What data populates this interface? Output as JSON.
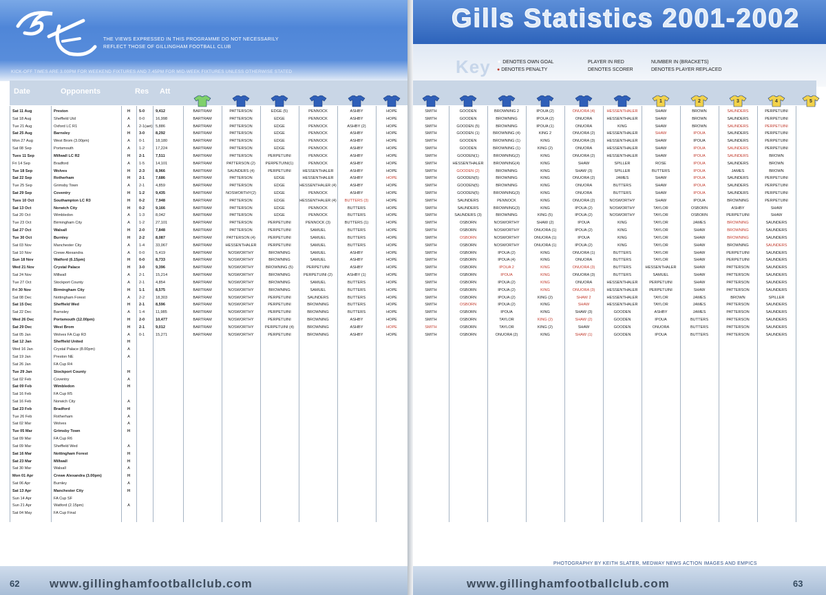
{
  "left": {
    "disclaimer_1": "THE VIEWS EXPRESSED IN THIS PROGRAMME DO NOT NECESSARILY",
    "disclaimer_2": "REFLECT THOSE OF GILLINGHAM FOOTBALL CLUB",
    "kickoff": "KICK-OFF TIMES ARE 3.00PM FOR WEEKEND FIXTURES AND 7.45PM FOR MID-WEEK FIXTURES UNLESS OTHERWISE STATED",
    "headers": [
      "Date",
      "Opponents",
      "Res",
      "Att"
    ],
    "page_number": "62",
    "url": "www.gillinghamfootballclub.com"
  },
  "right": {
    "title": "Gills Statistics 2001-2002",
    "key_title": "Key",
    "key": [
      "DENOTES OWN GOAL",
      "DENOTES PENALTY",
      "PLAYER IN RED",
      "DENOTES SCORER",
      "NUMBER IN (BRACKETS)",
      "DENOTES PLAYER REPLACED"
    ],
    "sub_numbers": [
      "1",
      "2",
      "3",
      "4",
      "5"
    ],
    "credit": "PHOTOGRAPHY BY KEITH SLATER, MEDWAY NEWS ACTION IMAGES AND EMPICS",
    "page_number": "63",
    "url": "www.gillinghamfootballclub.com"
  },
  "fixtures": [
    {
      "date": "Sat 11 Aug",
      "opp": "Preston",
      "ha": "H",
      "res": "5-0",
      "att": "9,412",
      "p": [
        "BARTRAM",
        "PATTERSON",
        "EDGE (5)",
        "PENNOCK",
        "ASHBY",
        "HOPE",
        "SMITH",
        "GOODEN",
        "BROWNING 2",
        "IPOUA (2)",
        "ONUORA (4)",
        "HESSENTHALER",
        "SHAW",
        "BROWN",
        "SAUNDERS",
        "PERPETUINI"
      ],
      "bold": true
    },
    {
      "date": "Sat 18 Aug",
      "opp": "Sheffield Utd",
      "ha": "A",
      "res": "0-0",
      "att": "16,998",
      "p": [
        "BARTRAM",
        "PATTERSON",
        "EDGE",
        "PENNOCK",
        "ASHBY",
        "HOPE",
        "SMITH",
        "GOODEN",
        "BROWNING",
        "IPOUA (2)",
        "ONUORA",
        "HESSENTHALER",
        "SHAW",
        "BROWN",
        "SAUNDERS",
        "PERPETUINI"
      ]
    },
    {
      "date": "Tue 21 Aug",
      "opp": "Oxford LC R1",
      "ha": "A",
      "res": "2-1(aet)",
      "att": "5,886",
      "p": [
        "BARTRAM",
        "PATTERSON",
        "EDGE",
        "PENNOCK",
        "ASHBY (2)",
        "HOPE",
        "SMITH",
        "GOODEN (5)",
        "BROWNING",
        "IPOUA (1)",
        "ONUORA",
        "KING",
        "SHAW",
        "BROWN",
        "SAUNDERS",
        "PERPETUINI"
      ]
    },
    {
      "date": "Sat 25 Aug",
      "opp": "Barnsley",
      "ha": "H",
      "res": "3-0",
      "att": "8,292",
      "p": [
        "BARTRAM",
        "PATTERSON",
        "EDGE",
        "PENNOCK",
        "ASHBY",
        "HOPE",
        "SMITH",
        "GOODEN (1)",
        "BROWNING (4)",
        "KING 2",
        "ONUORA (2)",
        "HESSENTHALER",
        "SHAW",
        "IPOUA",
        "SAUNDERS",
        "PERPETUINI"
      ],
      "bold": true
    },
    {
      "date": "Mon 27 Aug",
      "opp": "West Brom (3.00pm)",
      "ha": "A",
      "res": "0-1",
      "att": "18,180",
      "p": [
        "BARTRAM",
        "PATTERSON",
        "EDGE",
        "PENNOCK",
        "ASHBY",
        "HOPE",
        "SMITH",
        "GOODEN",
        "BROWNING (1)",
        "KING",
        "ONUORA (3)",
        "HESSENTHALER",
        "SHAW",
        "IPOUA",
        "SAUNDERS",
        "PERPETUINI"
      ]
    },
    {
      "date": "Sat 08 Sep",
      "opp": "Portsmouth",
      "ha": "A",
      "res": "1-2",
      "att": "17,224",
      "p": [
        "BARTRAM",
        "PATTERSON",
        "EDGE",
        "PENNOCK",
        "ASHBY",
        "HOPE",
        "SMITH",
        "GOODEN",
        "BROWNING (1)",
        "KING (2)",
        "ONUORA",
        "HESSENTHALER",
        "SHAW",
        "IPOUA",
        "SAUNDERS",
        "PERPETUINI"
      ]
    },
    {
      "date": "Tues 11 Sep",
      "opp": "Millwall LC R2",
      "ha": "H",
      "res": "2-1",
      "att": "7,511",
      "p": [
        "BARTRAM",
        "PATTERSON",
        "PERPETUINI",
        "PENNOCK",
        "ASHBY",
        "HOPE",
        "SMITH",
        "GOODEN(1)",
        "BROWNING(2)",
        "KING",
        "ONUORA (2)",
        "HESSENTHALER",
        "SHAW",
        "IPOUA",
        "SAUNDERS",
        "BROWN"
      ],
      "bold": true
    },
    {
      "date": "Fri 14 Sep",
      "opp": "Bradford",
      "ha": "A",
      "res": "1-5",
      "att": "14,101",
      "p": [
        "BARTRAM",
        "PATTERSON (2)",
        "PERPETUINI(1)",
        "PENNOCK",
        "ASHBY",
        "HOPE",
        "SMITH",
        "HESSENTHALER",
        "BROWNING(4)",
        "KING",
        "SHAW",
        "SPILLER",
        "ROSE",
        "IPOUA",
        "SAUNDERS",
        "BROWN"
      ]
    },
    {
      "date": "Tue 18 Sep",
      "opp": "Wolves",
      "ha": "H",
      "res": "2-3",
      "att": "8,966",
      "p": [
        "BARTRAM",
        "SAUNDERS (4)",
        "PERPETUINI",
        "HESSENTHALER",
        "ASHBY",
        "HOPE",
        "SMITH",
        "GOODEN (2)",
        "BROWNING",
        "KING",
        "SHAW (3)",
        "SPILLER",
        "BUTTERS",
        "IPOUA",
        "JAMES",
        "BROWN"
      ],
      "bold": true
    },
    {
      "date": "Sat 22 Sep",
      "opp": "Rotherham",
      "ha": "H",
      "res": "2-1",
      "att": "7,686",
      "p": [
        "BARTRAM",
        "PATTERSON",
        "EDGE",
        "HESSENTHALER",
        "ASHBY",
        "HOPE",
        "SMITH",
        "GOODEN(5)",
        "BROWNING",
        "KING",
        "ONUORA (2)",
        "JAMES",
        "SHAW",
        "IPOUA",
        "SAUNDERS",
        "PERPETUINI"
      ],
      "bold": true
    },
    {
      "date": "Tue 25 Sep",
      "opp": "Grimsby Town",
      "ha": "A",
      "res": "2-1",
      "att": "4,859",
      "p": [
        "BARTRAM",
        "PATTERSON",
        "EDGE",
        "HESSENTHALER (4)",
        "ASHBY",
        "HOPE",
        "SMITH",
        "GOODEN(5)",
        "BROWNING",
        "KING",
        "ONUORA",
        "BUTTERS",
        "SHAW",
        "IPOUA",
        "SAUNDERS",
        "PERPETUINI"
      ]
    },
    {
      "date": "Sat 29 Sep",
      "opp": "Coventry",
      "ha": "H",
      "res": "1-2",
      "att": "9,435",
      "p": [
        "BARTRAM",
        "NOSWORTHY(2)",
        "EDGE",
        "PENNOCK",
        "ASHBY",
        "HOPE",
        "SMITH",
        "GOODEN(5)",
        "BROWNING(3)",
        "KING",
        "ONUORA",
        "BUTTERS",
        "SHAW",
        "IPOUA",
        "SAUNDERS",
        "PERPETUINI"
      ],
      "bold": true
    },
    {
      "date": "Tues 10 Oct",
      "opp": "Southampton LC R3",
      "ha": "H",
      "res": "0-2",
      "att": "7,948",
      "p": [
        "BARTRAM",
        "PATTERSON",
        "EDGE",
        "HESSENTHALER (4)",
        "BUTTERS (3)",
        "HOPE",
        "SMITH",
        "SAUNDERS",
        "PENNOCK",
        "KING",
        "ONUORA (2)",
        "NOSWORTHY",
        "SHAW",
        "IPOUA",
        "BROWNING",
        "PERPETUINI"
      ],
      "bold": true
    },
    {
      "date": "Sat 13 Oct",
      "opp": "Norwich City",
      "ha": "H",
      "res": "0-2",
      "att": "9,166",
      "p": [
        "BARTRAM",
        "PATTERSON",
        "EDGE",
        "PENNOCK",
        "BUTTERS",
        "HOPE",
        "SMITH",
        "SAUNDERS",
        "BROWNING(3)",
        "KING",
        "IPOUA (2)",
        "NOSWORTHY",
        "TAYLOR",
        "OSBORN",
        "ASHBY",
        "SHAW"
      ],
      "bold": true
    },
    {
      "date": "Sat 20 Oct",
      "opp": "Wimbledon",
      "ha": "A",
      "res": "1-3",
      "att": "8,042",
      "p": [
        "BARTRAM",
        "PATTERSON",
        "EDGE",
        "PENNOCK",
        "BUTTERS",
        "HOPE",
        "SMITH",
        "SAUNDERS (3)",
        "BROWNING",
        "KING (5)",
        "IPOUA (2)",
        "NOSWORTHY",
        "TAYLOR",
        "OSBORN",
        "PERPETUINI",
        "SHAW"
      ]
    },
    {
      "date": "Tue 23 Oct",
      "opp": "Birmingham City",
      "ha": "A",
      "res": "1-2",
      "att": "27,101",
      "p": [
        "BARTRAM",
        "PATTERSON",
        "PERPETUINI",
        "PENNOCK (3)",
        "BUTTERS (1)",
        "HOPE",
        "SMITH",
        "OSBORN",
        "NOSWORTHY",
        "SHAW (2)",
        "IPOUA",
        "KING",
        "TAYLOR",
        "JAMES",
        "BROWNING",
        "SAUNDERS"
      ]
    },
    {
      "date": "Sat 27 Oct",
      "opp": "Walsall",
      "ha": "H",
      "res": "2-0",
      "att": "7,848",
      "p": [
        "BARTRAM",
        "PATTERSON",
        "PERPETUINI",
        "SAMUEL",
        "BUTTERS",
        "HOPE",
        "SMITH",
        "OSBORN",
        "NOSWORTHY",
        "ONUORA (1)",
        "IPOUA (2)",
        "KING",
        "TAYLOR",
        "SHAW",
        "BROWNING",
        "SAUNDERS"
      ],
      "bold": true
    },
    {
      "date": "Tue 30 Oct",
      "opp": "Burnley",
      "ha": "H",
      "res": "2-2",
      "att": "8,087",
      "p": [
        "BARTRAM",
        "PATTERSON (4)",
        "PERPETUINI",
        "SAMUEL",
        "BUTTERS",
        "HOPE",
        "SMITH",
        "OSBORN",
        "NOSWORTHY",
        "ONUORA (1)",
        "IPOUA",
        "KING",
        "TAYLOR",
        "SHAW",
        "BROWNING",
        "SAUNDERS"
      ],
      "bold": true
    },
    {
      "date": "Sat 03 Nov",
      "opp": "Manchester City",
      "ha": "A",
      "res": "1-4",
      "att": "33,067",
      "p": [
        "BARTRAM",
        "HESSENTHALER",
        "PERPETUINI",
        "SAMUEL",
        "BUTTERS",
        "HOPE",
        "SMITH",
        "OSBORN",
        "NOSWORTHY",
        "ONUORA (1)",
        "IPOUA (2)",
        "KING",
        "TAYLOR",
        "SHAW",
        "BROWNING",
        "SAUNDERS"
      ]
    },
    {
      "date": "Sat 10 Nov",
      "opp": "Crewe Alexandra",
      "ha": "A",
      "res": "0-0",
      "att": "5,419",
      "p": [
        "BARTRAM",
        "NOSWORTHY",
        "BROWNING",
        "SAMUEL",
        "ASHBY",
        "HOPE",
        "SMITH",
        "OSBORN",
        "IPOUA (2)",
        "KING",
        "ONUORA (1)",
        "BUTTERS",
        "TAYLOR",
        "SHAW",
        "PERPETUINI",
        "SAUNDERS"
      ]
    },
    {
      "date": "Sun 18 Nov",
      "opp": "Watford (6.15pm)",
      "ha": "H",
      "res": "0-0",
      "att": "8,733",
      "p": [
        "BARTRAM",
        "NOSWORTHY",
        "BROWNING",
        "SAMUEL",
        "ASHBY",
        "HOPE",
        "SMITH",
        "OSBORN",
        "IPOUA (4)",
        "KING",
        "ONUORA",
        "BUTTERS",
        "TAYLOR",
        "SHAW",
        "PERPETUINI",
        "SAUNDERS"
      ],
      "bold": true
    },
    {
      "date": "Wed 21 Nov",
      "opp": "Crystal Palace",
      "ha": "H",
      "res": "3-0",
      "att": "9,396",
      "p": [
        "BARTRAM",
        "NOSWORTHY",
        "BROWNING (5)",
        "PERPETUINI",
        "ASHBY",
        "HOPE",
        "SMITH",
        "OSBORN",
        "IPOUA 2",
        "KING",
        "ONUORA (3)",
        "BUTTERS",
        "HESSENTHALER",
        "SHAW",
        "PATTERSON",
        "SAUNDERS"
      ],
      "bold": true
    },
    {
      "date": "Sat 24 Nov",
      "opp": "Millwall",
      "ha": "A",
      "res": "2-1",
      "att": "15,214",
      "p": [
        "BARTRAM",
        "NOSWORTHY",
        "BROWNING",
        "PERPETUINI (2)",
        "ASHBY (1)",
        "HOPE",
        "SMITH",
        "OSBORN",
        "IPOUA",
        "KING",
        "ONUORA (3)",
        "BUTTERS",
        "SAMUEL",
        "SHAW",
        "PATTERSON",
        "SAUNDERS"
      ]
    },
    {
      "date": "Tue 27 Oct",
      "opp": "Stockport County",
      "ha": "A",
      "res": "2-1",
      "att": "4,854",
      "p": [
        "BARTRAM",
        "NOSWORTHY",
        "BROWNING",
        "SAMUEL",
        "BUTTERS",
        "HOPE",
        "SMITH",
        "OSBORN",
        "IPOUA (2)",
        "KING",
        "ONUORA",
        "HESSENTHALER",
        "PERPETUINI",
        "SHAW",
        "PATTERSON",
        "SAUNDERS"
      ]
    },
    {
      "date": "Fri 30 Nov",
      "opp": "Birmingham City",
      "ha": "H",
      "res": "1-1",
      "att": "8,575",
      "p": [
        "BARTRAM",
        "NOSWORTHY",
        "BROWNING",
        "SAMUEL",
        "BUTTERS",
        "HOPE",
        "SMITH",
        "OSBORN",
        "IPOUA (2)",
        "KING",
        "ONUORA (3)",
        "HESSENTHALER",
        "PERPETUINI",
        "SHAW",
        "PATTERSON",
        "SAUNDERS"
      ],
      "bold": true
    },
    {
      "date": "Sat 08 Dec",
      "opp": "Nottingham Forest",
      "ha": "A",
      "res": "2-2",
      "att": "18,303",
      "p": [
        "BARTRAM",
        "NOSWORTHY",
        "PERPETUINI",
        "SAUNDERS",
        "BUTTERS",
        "HOPE",
        "SMITH",
        "OSBORN",
        "IPOUA (2)",
        "KING (2)",
        "SHAW 2",
        "HESSENTHALER",
        "TAYLOR",
        "JAMES",
        "BROWN",
        "SPILLER"
      ]
    },
    {
      "date": "Sat 15 Dec",
      "opp": "Sheffield Wed",
      "ha": "H",
      "res": "2-1",
      "att": "8,596",
      "p": [
        "BARTRAM",
        "NOSWORTHY",
        "PERPETUINI",
        "BROWNING",
        "BUTTERS",
        "HOPE",
        "SMITH",
        "OSBORN",
        "IPOUA (2)",
        "KING",
        "SHAW",
        "HESSENTHALER",
        "TAYLOR",
        "JAMES",
        "PATTERSON",
        "SAUNDERS"
      ],
      "bold": true
    },
    {
      "date": "Sat 22 Dec",
      "opp": "Barnsley",
      "ha": "A",
      "res": "1-4",
      "att": "11,985",
      "p": [
        "BARTRAM",
        "NOSWORTHY",
        "PERPETUINI",
        "BROWNING",
        "BUTTERS",
        "HOPE",
        "SMITH",
        "OSBORN",
        "IPOUA",
        "KING",
        "SHAW (3)",
        "GOODEN",
        "ASHBY",
        "JAMES",
        "PATTERSON",
        "SAUNDERS"
      ]
    },
    {
      "date": "Wed 26 Dec",
      "opp": "Portsmouth (12.00pm)",
      "ha": "H",
      "res": "2-0",
      "att": "10,477",
      "p": [
        "BARTRAM",
        "NOSWORTHY",
        "PERPETUINI",
        "BROWNING",
        "ASHBY",
        "HOPE",
        "SMITH",
        "OSBORN",
        "TAYLOR",
        "KING (2)",
        "SHAW (2)",
        "GOODEN",
        "IPOUA",
        "BUTTERS",
        "PATTERSON",
        "SAUNDERS"
      ],
      "bold": true
    },
    {
      "date": "Sat 29 Dec",
      "opp": "West Brom",
      "ha": "H",
      "res": "2-1",
      "att": "9,012",
      "p": [
        "BARTRAM",
        "NOSWORTHY",
        "PERPETUINI (4)",
        "BROWNING",
        "ASHBY",
        "HOPE",
        "SMITH",
        "OSBORN",
        "TAYLOR",
        "KING (2)",
        "SHAW",
        "GOODEN",
        "ONUORA",
        "BUTTERS",
        "PATTERSON",
        "SAUNDERS"
      ],
      "bold": true
    },
    {
      "date": "Sat 05 Jan",
      "opp": "Wolves FA Cup R3",
      "ha": "A",
      "res": "0-1",
      "att": "15,271",
      "p": [
        "BARTRAM",
        "NOSWORTHY",
        "PERPETUINI",
        "BROWNING",
        "ASHBY",
        "HOPE",
        "SMITH",
        "OSBORN",
        "ONUORA (2)",
        "KING",
        "SHAW (1)",
        "GOODEN",
        "IPOUA",
        "BUTTERS",
        "PATTERSON",
        "SAUNDERS"
      ]
    },
    {
      "date": "Sat 12 Jan",
      "opp": "Sheffield United",
      "ha": "H",
      "bold": true
    },
    {
      "date": "Wed 16 Jan",
      "opp": "Crystal Palace (8.00pm)",
      "ha": "A"
    },
    {
      "date": "Sat 19 Jan",
      "opp": "Preston NE",
      "ha": "A"
    },
    {
      "date": "Sat 26 Jan",
      "opp": "FA Cup R4",
      "ha": ""
    },
    {
      "date": "Tue 29 Jan",
      "opp": "Stockport County",
      "ha": "H",
      "bold": true
    },
    {
      "date": "Sat 02 Feb",
      "opp": "Coventry",
      "ha": "A"
    },
    {
      "date": "Sat 09 Feb",
      "opp": "Wimbledon",
      "ha": "H",
      "bold": true
    },
    {
      "date": "Sat 16 Feb",
      "opp": "FA Cup R5",
      "ha": ""
    },
    {
      "date": "Sat 16 Feb",
      "opp": "Norwich City",
      "ha": "A"
    },
    {
      "date": "Sat 23 Feb",
      "opp": "Bradford",
      "ha": "H",
      "bold": true
    },
    {
      "date": "Tue 26 Feb",
      "opp": "Rotherham",
      "ha": "A"
    },
    {
      "date": "Sat 02 Mar",
      "opp": "Wolves",
      "ha": "A"
    },
    {
      "date": "Tue 05 Mar",
      "opp": "Grimsby Town",
      "ha": "H",
      "bold": true
    },
    {
      "date": "Sat 09 Mar",
      "opp": "FA Cup R6",
      "ha": ""
    },
    {
      "date": "Sat 09 Mar",
      "opp": "Sheffield Wed",
      "ha": "A"
    },
    {
      "date": "Sat 16 Mar",
      "opp": "Nottingham Forest",
      "ha": "H",
      "bold": true
    },
    {
      "date": "Sat 23 Mar",
      "opp": "Millwall",
      "ha": "H",
      "bold": true
    },
    {
      "date": "Sat 30 Mar",
      "opp": "Walsall",
      "ha": "A"
    },
    {
      "date": "Mon 01 Apr",
      "opp": "Crewe Alexandra (3.00pm)",
      "ha": "H",
      "bold": true
    },
    {
      "date": "Sat 06 Apr",
      "opp": "Burnley",
      "ha": "A"
    },
    {
      "date": "Sat 13 Apr",
      "opp": "Manchester City",
      "ha": "H",
      "bold": true
    },
    {
      "date": "Sun 14 Apr",
      "opp": "FA Cup SF",
      "ha": ""
    },
    {
      "date": "Sun 21 Apr",
      "opp": "Watford (2.15pm)",
      "ha": "A"
    },
    {
      "date": "Sat 04 May",
      "opp": "FA Cup Final",
      "ha": ""
    }
  ],
  "colors": {
    "blue_band": "#4f86d8",
    "shirt_blue": "#2f5fb8",
    "shirt_green": "#7fd06b",
    "shirt_yellow": "#f2d24a",
    "red_text": "#c0392b"
  }
}
